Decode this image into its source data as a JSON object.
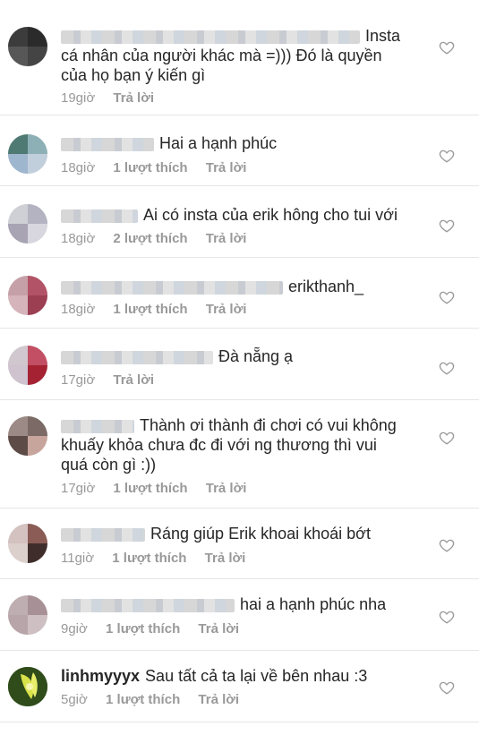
{
  "comments": [
    {
      "text_lines": [
        "Insta",
        "cá nhân của người khác mà =))) Đó là quyền",
        "của họ bạn ý kiến gì"
      ],
      "time": "19giờ",
      "likes": "",
      "reply": "Trả lời"
    },
    {
      "text": "Hai a hạnh phúc",
      "time": "18giờ",
      "likes": "1 lượt thích",
      "reply": "Trả lời"
    },
    {
      "text": "Ai có insta của erik hông cho tui với",
      "time": "18giờ",
      "likes": "2 lượt thích",
      "reply": "Trả lời"
    },
    {
      "text": "erikthanh_",
      "time": "18giờ",
      "likes": "1 lượt thích",
      "reply": "Trả lời"
    },
    {
      "text": "Đà nẵng ạ",
      "time": "17giờ",
      "likes": "",
      "reply": "Trả lời"
    },
    {
      "text_lines": [
        "Thành ơi thành đi chơi có vui không",
        "khuấy khỏa chưa đc đi với ng thương thì vui",
        "quá còn gì :))"
      ],
      "time": "17giờ",
      "likes": "1 lượt thích",
      "reply": "Trả lời"
    },
    {
      "text": "Ráng giúp Erik khoai khoái bớt",
      "time": "11giờ",
      "likes": "1 lượt thích",
      "reply": "Trả lời"
    },
    {
      "text": "hai a hạnh phúc nha",
      "time": "9giờ",
      "likes": "1 lượt thích",
      "reply": "Trả lời"
    },
    {
      "username": "linhmyyyx",
      "text": "Sau tất cả ta lại về bên nhau :3",
      "time": "5giờ",
      "likes": "1 lượt thích",
      "reply": "Trả lời"
    }
  ],
  "icons": {
    "like": "heart-outline-icon"
  }
}
